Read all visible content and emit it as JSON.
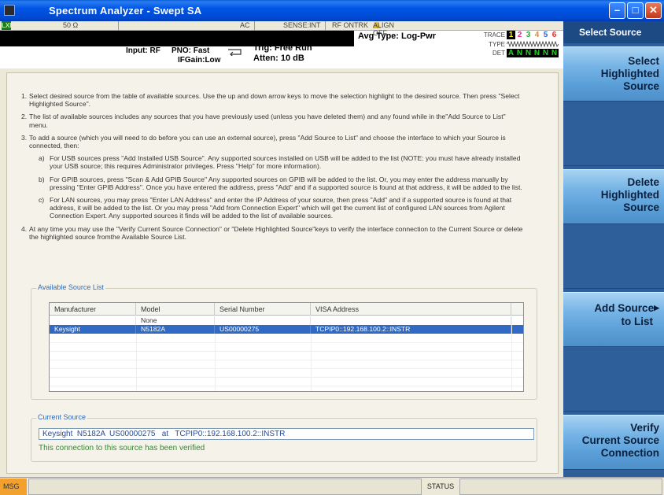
{
  "window": {
    "title": "Spectrum Analyzer - Swept SA",
    "minimize_icon": "minimize-icon",
    "maximize_icon": "maximize-icon",
    "close_icon": "close-icon"
  },
  "header": {
    "lxi": "LXI",
    "impedance": "50 Ω",
    "coupling": "AC",
    "sense": "SENSE:INT",
    "rf_ontrk": "RF ONTRK",
    "align": "ALIGN OFF",
    "input": "Input: RF",
    "pno": "PNO: Fast",
    "ifgain": "IFGain:Low",
    "trig": "Trig: Free Run",
    "atten": "Atten: 10 dB",
    "avg_type": "Avg Type: Log-Pwr",
    "trace_label": "TRACE",
    "type_label": "TYPE",
    "det_label": "DET",
    "trace_numbers": [
      "1",
      "2",
      "3",
      "4",
      "5",
      "6"
    ],
    "det_values": [
      "A",
      "N",
      "N",
      "N",
      "N",
      "N"
    ],
    "trace_colors": [
      "#ffff00",
      "#e0308a",
      "#1faa2e",
      "#e08a2a",
      "#3060e0",
      "#e02a2a"
    ]
  },
  "instructions": {
    "item1_num": "1.",
    "item1": "Select desired source from the table of available sources. Use the up and down arrow keys to move the selection highlight to the desired source. Then press \"Select Highlighted Source\".",
    "item2_num": "2.",
    "item2": "The list of available sources includes any sources that you have previously used (unless you have deleted them) and any found while in the\"Add Source to List\" menu.",
    "item3_num": "3.",
    "item3": "To add a source (which you will need to do before you can use an external source), press \"Add Source to List\" and choose the interface to which your Source is connected, then:",
    "item3a_letter": "a)",
    "item3a": "For USB sources press \"Add Installed USB Source\". Any supported sources installed on USB will be added to the list (NOTE: you must have already installed your USB source; this requires Administrator privileges. Press \"Help\" for more information).",
    "item3b_letter": "b)",
    "item3b": "For GPIB sources, press \"Scan & Add GPIB Source\" Any supported sources on GPIB will be added to the list. Or, you may enter the address manually by pressing \"Enter GPIB Address\". Once you have entered the address, press \"Add\" and if a supported source is found at that address, it will be added to the list.",
    "item3c_letter": "c)",
    "item3c": "For LAN sources, you may press \"Enter LAN Address\" and enter the IP Address of your source, then press \"Add\" and if a supported source is found at that address, it will be added to the list. Or you may press \"Add from Connection Expert\" which will get the current list of configured LAN sources from Agilent Connection Expert. Any supported sources it finds will be added to the list of available sources.",
    "item4_num": "4.",
    "item4": "At any time you may use the \"Verify Current Source Connection\" or \"Delete Highlighted Source\"keys to verify the interface connection to the Current Source or delete the highlighted source fromthe Available Source List."
  },
  "source_list": {
    "legend": "Available Source List",
    "columns": [
      "Manufacturer",
      "Model",
      "Serial Number",
      "VISA Address"
    ],
    "rows": [
      {
        "manufacturer": "",
        "model": "None",
        "serial": "",
        "visa": ""
      },
      {
        "manufacturer": "Keysight",
        "model": "N5182A",
        "serial": "US00000275",
        "visa": "TCPIP0::192.168.100.2::INSTR"
      }
    ]
  },
  "current_source": {
    "legend": "Current Source",
    "value": "Keysight  N5182A  US00000275   at   TCPIP0::192.168.100.2::INSTR",
    "status": "This connection to this source has been verified"
  },
  "softkeys": {
    "menu_title": "Select Source",
    "sk1": [
      "Select",
      "Highlighted",
      "Source"
    ],
    "sk2": [
      "Delete",
      "Highlighted",
      "Source"
    ],
    "sk3": [
      "Add Source",
      "to List"
    ],
    "sk4": [
      "Verify",
      "Current Source",
      "Connection"
    ]
  },
  "statusbar": {
    "msg": "MSG",
    "status": "STATUS"
  }
}
